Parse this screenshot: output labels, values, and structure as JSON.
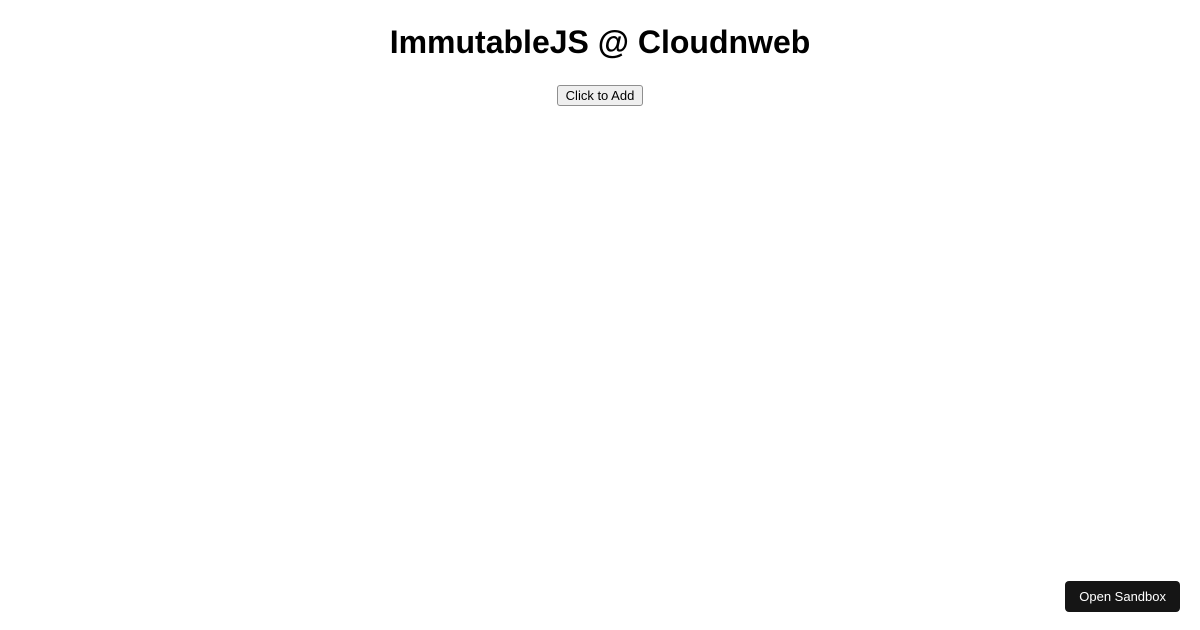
{
  "main": {
    "heading": "ImmutableJS @ Cloudnweb",
    "add_button_label": "Click to Add"
  },
  "footer": {
    "open_sandbox_label": "Open Sandbox"
  }
}
